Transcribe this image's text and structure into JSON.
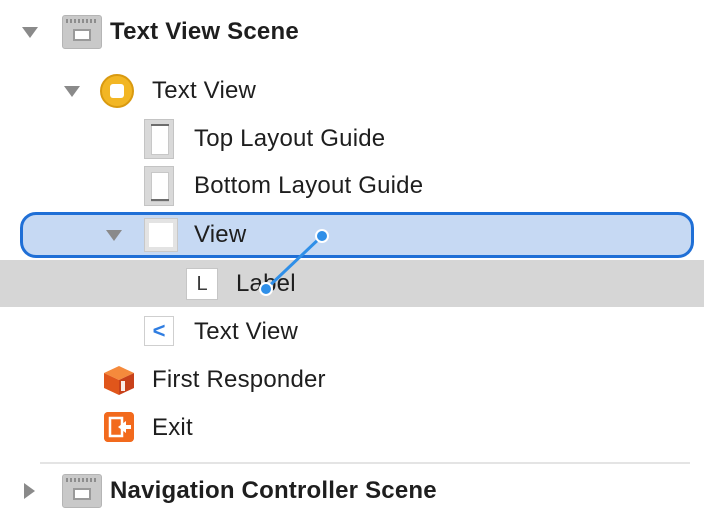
{
  "outline": {
    "items": [
      {
        "label": "Text View Scene",
        "icon": "scene-icon",
        "expanded": true
      },
      {
        "label": "Text View",
        "icon": "view-controller-icon",
        "expanded": true
      },
      {
        "label": "Top Layout Guide",
        "icon": "top-layout-guide-icon"
      },
      {
        "label": "Bottom Layout Guide",
        "icon": "bottom-layout-guide-icon"
      },
      {
        "label": "View",
        "icon": "view-icon",
        "expanded": true,
        "selected": true
      },
      {
        "label": "Label",
        "icon": "label-icon",
        "icon_glyph": "L"
      },
      {
        "label": "Text View",
        "icon": "back-chevron-icon",
        "icon_glyph": "<"
      },
      {
        "label": "First Responder",
        "icon": "first-responder-icon"
      },
      {
        "label": "Exit",
        "icon": "exit-icon"
      },
      {
        "label": "Navigation Controller Scene",
        "icon": "scene-icon",
        "expanded": false
      }
    ]
  },
  "colors": {
    "selection_border": "#1f6fd6",
    "selection_fill": "#c6d9f3",
    "hover_row": "#d6d6d6",
    "connector": "#2f8fe8"
  }
}
